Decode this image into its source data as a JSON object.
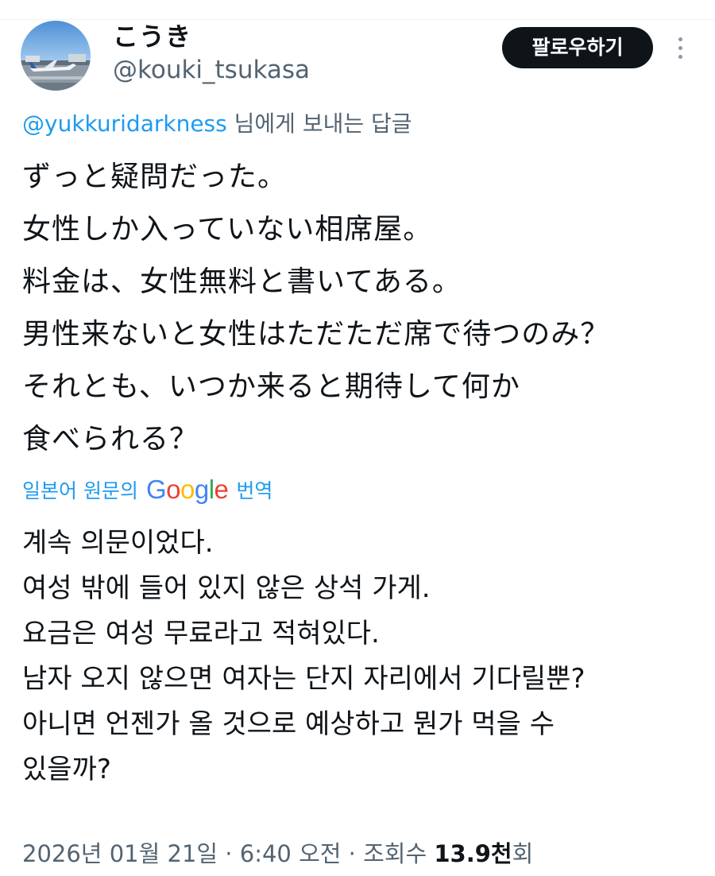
{
  "author": {
    "display_name": "こうき",
    "handle": "@kouki_tsukasa",
    "avatar_icon": "airport-photo-avatar"
  },
  "actions": {
    "follow_label": "팔로우하기",
    "more_icon": "more-vertical-icon"
  },
  "reply": {
    "mention": "@yukkuridarkness",
    "suffix": " 님에게 보내는 답글"
  },
  "tweet": {
    "lines": [
      "ずっと疑問だった。",
      "女性しか入っていない相席屋。",
      "料金は、女性無料と書いてある。",
      "男性来ないと女性はただただ席で待つのみ？",
      "それとも、いつか来ると期待して何か",
      "食べられる？"
    ]
  },
  "translation": {
    "prefix": "일본어 원문의",
    "google_letters": [
      "G",
      "o",
      "o",
      "g",
      "l",
      "e"
    ],
    "google_colors": [
      "#4285f4",
      "#ea4335",
      "#fbbc05",
      "#4285f4",
      "#34a853",
      "#ea4335"
    ],
    "suffix": "번역",
    "lines": [
      "계속 의문이었다.",
      "여성 밖에 들어 있지 않은 상석 가게.",
      "요금은 여성 무료라고 적혀있다.",
      "남자 오지 않으면 여자는 단지 자리에서 기다릴뿐?",
      "아니면 언젠가 올 것으로 예상하고 뭔가 먹을 수",
      "있을까?"
    ]
  },
  "meta": {
    "date": "2026년 01월 21일",
    "separator": " · ",
    "time": "6:40 오전",
    "views_label": "조회수",
    "views_count": "13.9천",
    "views_suffix": "회"
  },
  "colors": {
    "accent": "#1d9bf0",
    "secondary_text": "#536471",
    "button_bg": "#0f1419"
  }
}
